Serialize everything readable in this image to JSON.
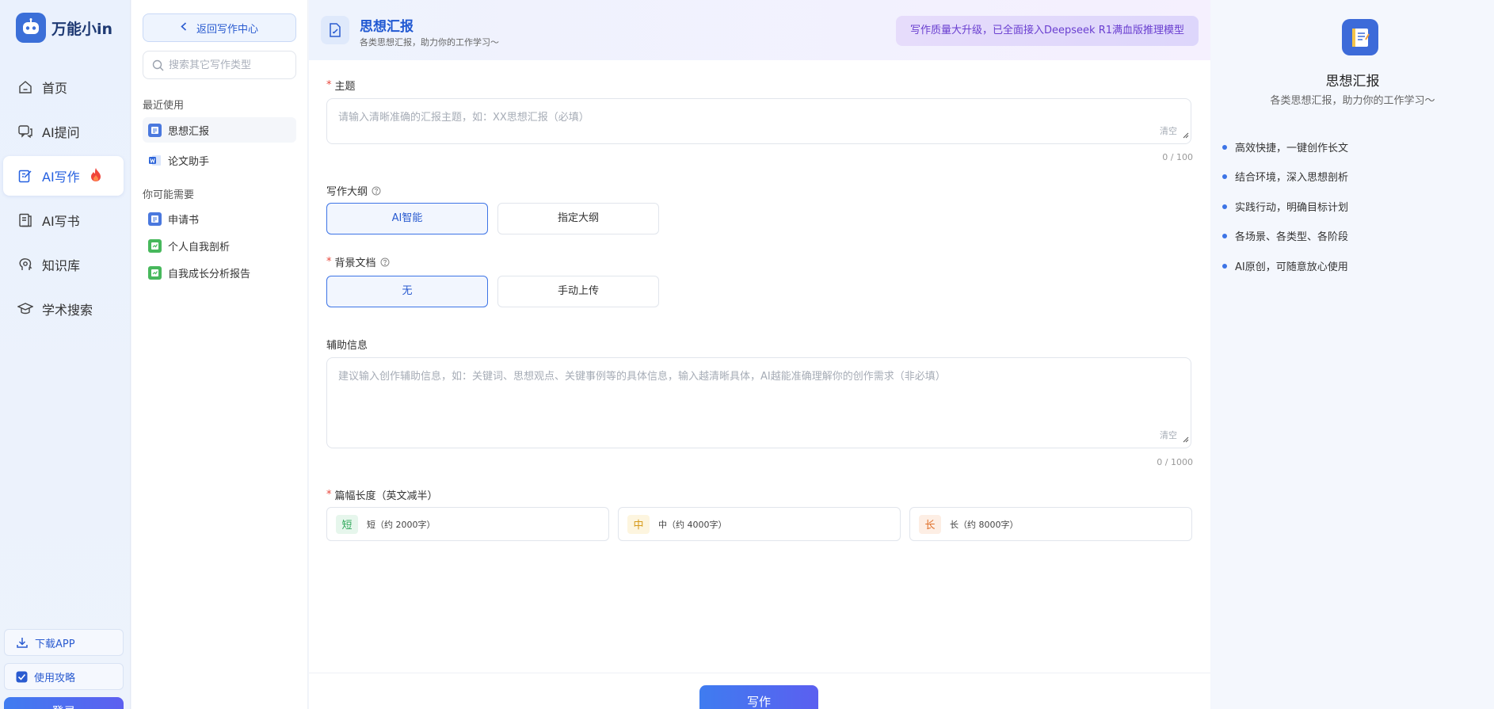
{
  "app": {
    "name": "万能小in"
  },
  "nav": {
    "items": [
      {
        "label": "首页",
        "icon": "home-icon"
      },
      {
        "label": "AI提问",
        "icon": "chat-icon"
      },
      {
        "label": "AI写作",
        "icon": "edit-icon",
        "active": true
      },
      {
        "label": "AI写书",
        "icon": "book-icon"
      },
      {
        "label": "知识库",
        "icon": "brain-icon"
      },
      {
        "label": "学术搜索",
        "icon": "graduation-cap-icon"
      }
    ],
    "download_app": "下载APP",
    "guide": "使用攻略",
    "login": "登录"
  },
  "panel": {
    "back_label": "返回写作中心",
    "search_placeholder": "搜索其它写作类型",
    "recent_title": "最近使用",
    "recent": [
      {
        "label": "思想汇报",
        "icon": "document-icon"
      },
      {
        "label": "论文助手",
        "icon": "word-doc-icon"
      }
    ],
    "maybe_title": "你可能需要",
    "maybe": [
      {
        "label": "申请书",
        "icon": "document-icon"
      },
      {
        "label": "个人自我剖析",
        "icon": "green-doc-icon"
      },
      {
        "label": "自我成长分析报告",
        "icon": "green-doc-icon"
      }
    ]
  },
  "header": {
    "title": "思想汇报",
    "subtitle": "各类思想汇报，助力你的工作学习～",
    "promo": "写作质量大升级，已全面接入Deepseek R1满血版推理模型"
  },
  "form": {
    "topic": {
      "label": "主题",
      "placeholder": "请输入清晰准确的汇报主题，如：XX思想汇报（必填）",
      "clear": "清空",
      "counter": "0 / 100"
    },
    "outline": {
      "label": "写作大纲",
      "options": [
        "AI智能",
        "指定大纲"
      ],
      "selected": "AI智能"
    },
    "background": {
      "label": "背景文档",
      "options": [
        "无",
        "手动上传"
      ],
      "selected": "无"
    },
    "aux": {
      "label": "辅助信息",
      "placeholder": "建议输入创作辅助信息，如：关键词、思想观点、关键事例等的具体信息，输入越清晰具体，AI越能准确理解你的创作需求（非必填）",
      "clear": "清空",
      "counter": "0 / 1000"
    },
    "length": {
      "label": "篇幅长度（英文减半）",
      "options": [
        {
          "tag": "短",
          "text": "短（约 2000字）",
          "tag_color": "#2fa85a",
          "tag_bg": "#e6f6ec"
        },
        {
          "tag": "中",
          "text": "中（约 4000字）",
          "tag_color": "#d69a1a",
          "tag_bg": "#fdf5df"
        },
        {
          "tag": "长",
          "text": "长（约 8000字）",
          "tag_color": "#e0702a",
          "tag_bg": "#fdeee4"
        }
      ]
    },
    "submit": "写作"
  },
  "info": {
    "title": "思想汇报",
    "subtitle": "各类思想汇报，助力你的工作学习～",
    "features": [
      "高效快捷，一键创作长文",
      "结合环境，深入思想剖析",
      "实践行动，明确目标计划",
      "各场景、各类型、各阶段",
      "AI原创，可随意放心使用"
    ]
  },
  "colors": {
    "accent": "#2a5bd0",
    "required": "#e8473c",
    "promo_text": "#6a3fd0"
  }
}
